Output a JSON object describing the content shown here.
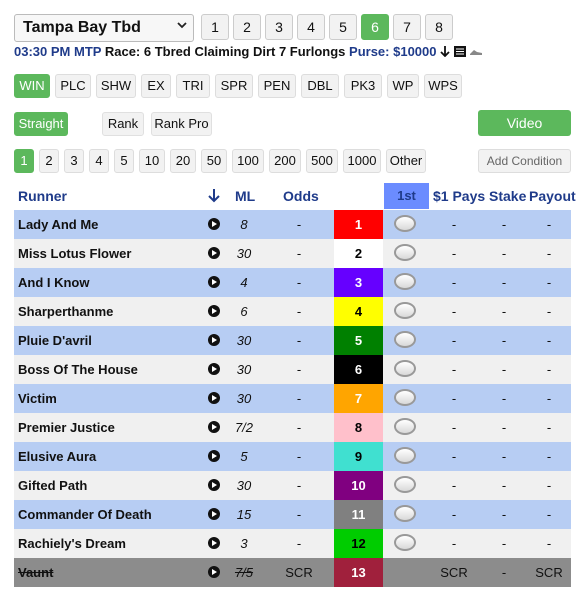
{
  "track": {
    "name": "Tampa Bay Tbd"
  },
  "races": [
    {
      "label": "1",
      "active": false
    },
    {
      "label": "2",
      "active": false
    },
    {
      "label": "3",
      "active": false
    },
    {
      "label": "4",
      "active": false
    },
    {
      "label": "5",
      "active": false
    },
    {
      "label": "6",
      "active": true
    },
    {
      "label": "7",
      "active": false
    },
    {
      "label": "8",
      "active": false
    }
  ],
  "info": {
    "time": "03:30 PM",
    "mtp": "MTP",
    "race": "Race: 6",
    "details": "Tbred Claiming Dirt 7 Furlongs",
    "purse": "Purse: $10000"
  },
  "bet_types": [
    {
      "label": "WIN",
      "active": true
    },
    {
      "label": "PLC",
      "active": false
    },
    {
      "label": "SHW",
      "active": false
    },
    {
      "label": "EX",
      "active": false
    },
    {
      "label": "TRI",
      "active": false
    },
    {
      "label": "SPR",
      "active": false
    },
    {
      "label": "PEN",
      "active": false
    },
    {
      "label": "DBL",
      "active": false
    },
    {
      "label": "PK3",
      "active": false
    },
    {
      "label": "WP",
      "active": false
    },
    {
      "label": "WPS",
      "active": false
    }
  ],
  "options": {
    "straight": "Straight",
    "rank": "Rank",
    "rank_pro": "Rank Pro",
    "video": "Video"
  },
  "amounts": [
    {
      "label": "1",
      "active": true
    },
    {
      "label": "2",
      "active": false
    },
    {
      "label": "3",
      "active": false
    },
    {
      "label": "4",
      "active": false
    },
    {
      "label": "5",
      "active": false
    },
    {
      "label": "10",
      "active": false
    },
    {
      "label": "20",
      "active": false
    },
    {
      "label": "50",
      "active": false
    },
    {
      "label": "100",
      "active": false
    },
    {
      "label": "200",
      "active": false
    },
    {
      "label": "500",
      "active": false
    },
    {
      "label": "1000",
      "active": false
    },
    {
      "label": "Other",
      "active": false
    }
  ],
  "add_condition": "Add Condition",
  "headers": {
    "runner": "Runner",
    "ml": "ML",
    "odds": "Odds",
    "first": "1st",
    "pays": "$1 Pays",
    "stake": "Stake",
    "payout": "Payout"
  },
  "colors": {
    "row_blue": "#b7cdf3",
    "row_white": "#f0f0f0",
    "accent_green": "#5cb85c",
    "header_blue": "#1f3b8a",
    "scr_gray": "#8c8c8c"
  },
  "runners": [
    {
      "name": "Lady And Me",
      "ml": "8",
      "odds": "-",
      "num": "1",
      "bg": "#ff0000",
      "fg": "#ffffff",
      "pays": "-",
      "stake": "-",
      "payout": "-",
      "scr": false
    },
    {
      "name": "Miss Lotus Flower",
      "ml": "30",
      "odds": "-",
      "num": "2",
      "bg": "#ffffff",
      "fg": "#000000",
      "pays": "-",
      "stake": "-",
      "payout": "-",
      "scr": false
    },
    {
      "name": "And I Know",
      "ml": "4",
      "odds": "-",
      "num": "3",
      "bg": "#6600ff",
      "fg": "#ffffff",
      "pays": "-",
      "stake": "-",
      "payout": "-",
      "scr": false
    },
    {
      "name": "Sharperthanme",
      "ml": "6",
      "odds": "-",
      "num": "4",
      "bg": "#ffff00",
      "fg": "#000000",
      "pays": "-",
      "stake": "-",
      "payout": "-",
      "scr": false
    },
    {
      "name": "Pluie D'avril",
      "ml": "30",
      "odds": "-",
      "num": "5",
      "bg": "#008000",
      "fg": "#ffffff",
      "pays": "-",
      "stake": "-",
      "payout": "-",
      "scr": false
    },
    {
      "name": "Boss Of The House",
      "ml": "30",
      "odds": "-",
      "num": "6",
      "bg": "#000000",
      "fg": "#ffffff",
      "pays": "-",
      "stake": "-",
      "payout": "-",
      "scr": false
    },
    {
      "name": "Victim",
      "ml": "30",
      "odds": "-",
      "num": "7",
      "bg": "#ffa500",
      "fg": "#ffffff",
      "pays": "-",
      "stake": "-",
      "payout": "-",
      "scr": false
    },
    {
      "name": "Premier Justice",
      "ml": "7/2",
      "odds": "-",
      "num": "8",
      "bg": "#ffc0cb",
      "fg": "#000000",
      "pays": "-",
      "stake": "-",
      "payout": "-",
      "scr": false
    },
    {
      "name": "Elusive Aura",
      "ml": "5",
      "odds": "-",
      "num": "9",
      "bg": "#40e0d0",
      "fg": "#000000",
      "pays": "-",
      "stake": "-",
      "payout": "-",
      "scr": false
    },
    {
      "name": "Gifted Path",
      "ml": "30",
      "odds": "-",
      "num": "10",
      "bg": "#800080",
      "fg": "#ffffff",
      "pays": "-",
      "stake": "-",
      "payout": "-",
      "scr": false
    },
    {
      "name": "Commander Of Death",
      "ml": "15",
      "odds": "-",
      "num": "11",
      "bg": "#808080",
      "fg": "#ffffff",
      "pays": "-",
      "stake": "-",
      "payout": "-",
      "scr": false
    },
    {
      "name": "Rachiely's Dream",
      "ml": "3",
      "odds": "-",
      "num": "12",
      "bg": "#00cc00",
      "fg": "#000000",
      "pays": "-",
      "stake": "-",
      "payout": "-",
      "scr": false
    },
    {
      "name": "Vaunt",
      "ml": "7/5",
      "odds": "SCR",
      "num": "13",
      "bg": "#a0203c",
      "fg": "#ffffff",
      "pays": "SCR",
      "stake": "-",
      "payout": "SCR",
      "scr": true
    }
  ]
}
